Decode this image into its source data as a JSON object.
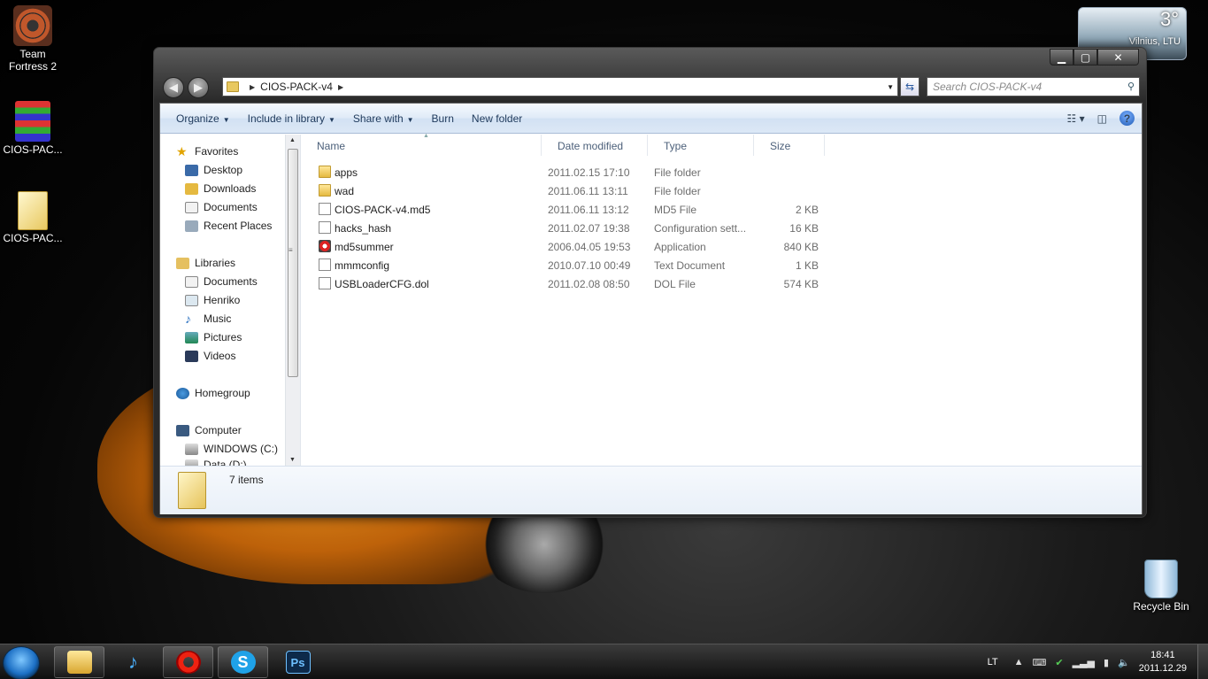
{
  "desktop": {
    "icons": [
      {
        "label": "Team\nFortress 2",
        "icon": "tf2-game-icon"
      },
      {
        "label": "CIOS-PAC...",
        "icon": "winrar-archive-icon"
      },
      {
        "label": "CIOS-PAC...",
        "icon": "folder-icon"
      },
      {
        "label": "Recycle Bin",
        "icon": "recycle-bin-icon"
      }
    ],
    "weather": {
      "temp": "3°",
      "city": "Vilnius, LTU"
    }
  },
  "window": {
    "controls": {
      "minimize": "▁",
      "maximize": "▢",
      "close": "✕"
    },
    "address": {
      "path": "CIOS-PACK-v4"
    },
    "search": {
      "placeholder": "Search CIOS-PACK-v4"
    },
    "toolbar": {
      "organize": "Organize",
      "include": "Include in library",
      "share": "Share with",
      "burn": "Burn",
      "new_folder": "New folder"
    },
    "nav": {
      "favorites": "Favorites",
      "desktop": "Desktop",
      "downloads": "Downloads",
      "documents": "Documents",
      "recent": "Recent Places",
      "libraries": "Libraries",
      "lib_documents": "Documents",
      "henriko": "Henriko",
      "music": "Music",
      "pictures": "Pictures",
      "videos": "Videos",
      "homegroup": "Homegroup",
      "computer": "Computer",
      "drive_c": "WINDOWS (C:)",
      "drive_d": "Data (D:)"
    },
    "columns": {
      "name": "Name",
      "date": "Date modified",
      "type": "Type",
      "size": "Size"
    },
    "files": [
      {
        "name": "apps",
        "date": "2011.02.15 17:10",
        "type": "File folder",
        "size": "",
        "icon": "folder"
      },
      {
        "name": "wad",
        "date": "2011.06.11 13:11",
        "type": "File folder",
        "size": "",
        "icon": "folder"
      },
      {
        "name": "CIOS-PACK-v4.md5",
        "date": "2011.06.11 13:12",
        "type": "MD5 File",
        "size": "2 KB",
        "icon": "file"
      },
      {
        "name": "hacks_hash",
        "date": "2011.02.07 19:38",
        "type": "Configuration sett...",
        "size": "16 KB",
        "icon": "cfg"
      },
      {
        "name": "md5summer",
        "date": "2006.04.05 19:53",
        "type": "Application",
        "size": "840 KB",
        "icon": "app"
      },
      {
        "name": "mmmconfig",
        "date": "2010.07.10 00:49",
        "type": "Text Document",
        "size": "1 KB",
        "icon": "file"
      },
      {
        "name": "USBLoaderCFG.dol",
        "date": "2011.02.08 08:50",
        "type": "DOL File",
        "size": "574 KB",
        "icon": "file"
      }
    ],
    "status": {
      "count": "7 items"
    }
  },
  "taskbar": {
    "buttons": [
      {
        "glyph": "",
        "icon": "explorer-icon"
      },
      {
        "glyph": "♪",
        "icon": "music-player-icon"
      },
      {
        "glyph": "O",
        "icon": "opera-icon"
      },
      {
        "glyph": "S",
        "icon": "skype-icon"
      },
      {
        "glyph": "Ps",
        "icon": "photoshop-icon"
      }
    ],
    "tray": {
      "lang": "LT",
      "time": "18:41",
      "date": "2011.12.29"
    }
  }
}
